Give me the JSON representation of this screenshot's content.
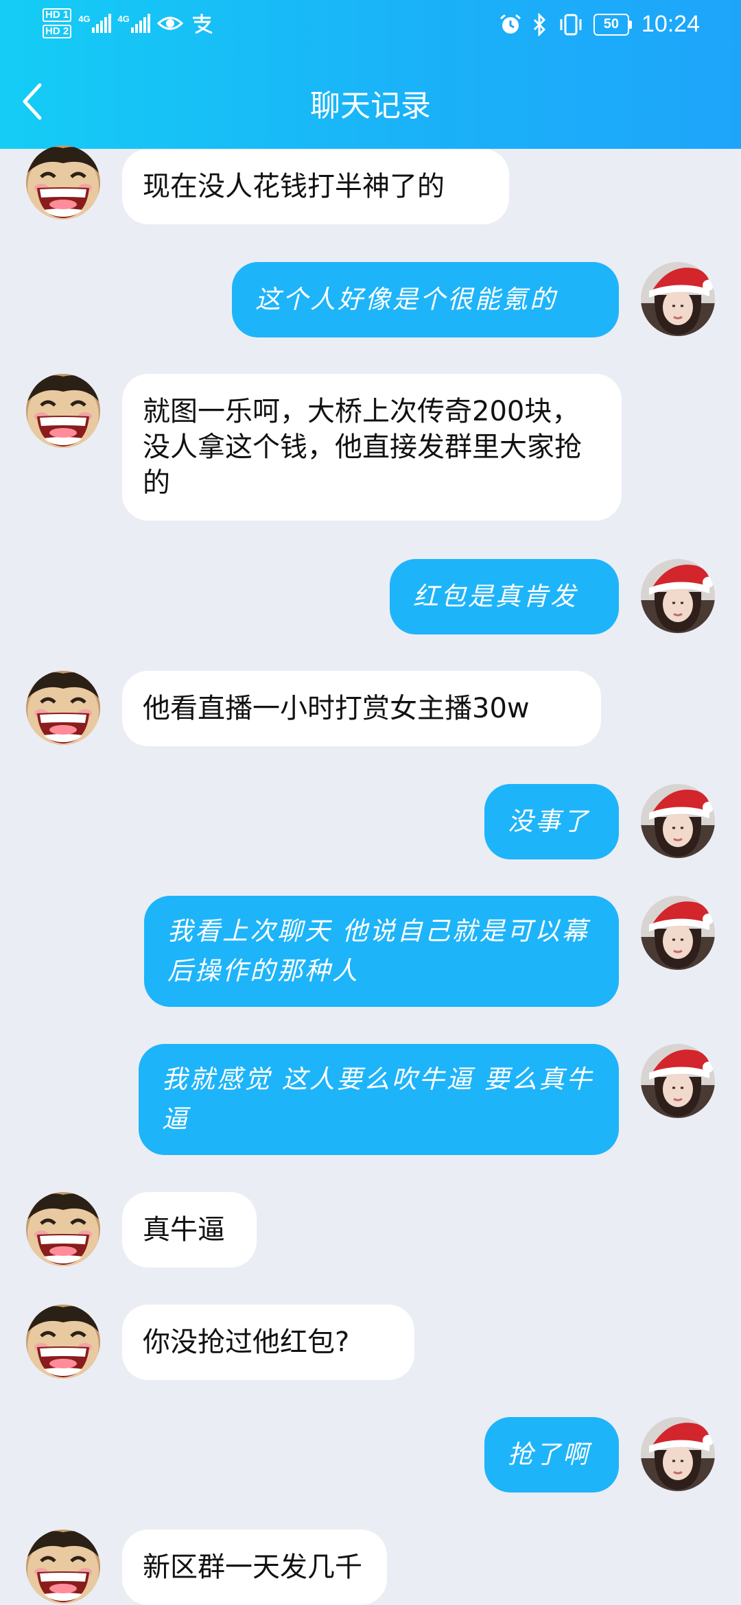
{
  "status_bar": {
    "sim1": "HD 1",
    "sim2": "HD 2",
    "network1": "4G",
    "network2": "4G",
    "battery": "50",
    "time": "10:24",
    "icons": [
      "eye-icon",
      "alipay-icon",
      "alarm-icon",
      "bluetooth-icon",
      "vibrate-icon"
    ]
  },
  "header": {
    "title": "聊天记录",
    "back_icon": "chevron-left-icon"
  },
  "colors": {
    "header_start": "#14cdf5",
    "header_end": "#1ea5fb",
    "incoming_bubble": "#ffffff",
    "outgoing_bubble": "#1eb4fa",
    "background": "#ebedf5"
  },
  "messages": [
    {
      "side": "left",
      "text": "现在没人花钱打半神了的"
    },
    {
      "side": "right",
      "text": "这个人好像是个很能氪的"
    },
    {
      "side": "left",
      "text": "就图一乐呵，大桥上次传奇200块，没人拿这个钱，他直接发群里大家抢的"
    },
    {
      "side": "right",
      "text": "红包是真肯发"
    },
    {
      "side": "left",
      "text": "他看直播一小时打赏女主播30w"
    },
    {
      "side": "right",
      "text": "没事了"
    },
    {
      "side": "right",
      "text": "我看上次聊天  他说自己就是可以幕后操作的那种人"
    },
    {
      "side": "right",
      "text": "我就感觉   这人要么吹牛逼  要么真牛逼"
    },
    {
      "side": "left",
      "text": "真牛逼"
    },
    {
      "side": "left",
      "text": "你没抢过他红包?"
    },
    {
      "side": "right",
      "text": "抢了啊"
    },
    {
      "side": "left",
      "text": "新区群一天发几千"
    }
  ]
}
